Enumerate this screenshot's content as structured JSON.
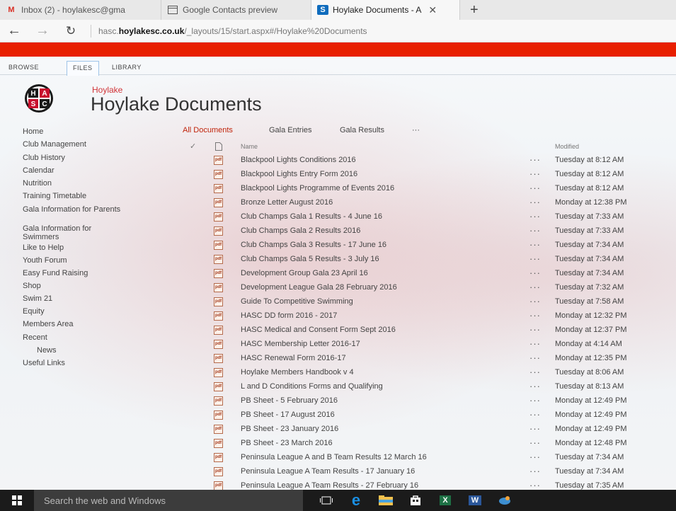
{
  "browser": {
    "tabs": [
      {
        "icon": "gmail-icon",
        "label": "Inbox (2) - hoylakesc@gma",
        "active": false
      },
      {
        "icon": "contacts-icon",
        "label": "Google Contacts preview",
        "active": false
      },
      {
        "icon": "sharepoint-icon",
        "label": "Hoylake Documents - A",
        "active": true
      }
    ],
    "url_prefix": "hasc.",
    "url_domain": "hoylakesc.co.uk",
    "url_path": "/_layouts/15/start.aspx#/Hoylake%20Documents"
  },
  "ribbon": {
    "tabs": [
      "BROWSE",
      "FILES",
      "LIBRARY"
    ]
  },
  "site": {
    "subtitle": "Hoylake",
    "title": "Hoylake Documents",
    "logo_letters": [
      "H",
      "A",
      "S",
      "C"
    ]
  },
  "nav": [
    {
      "label": "Home",
      "sub": false
    },
    {
      "label": "Club Management",
      "sub": false
    },
    {
      "label": "Club History",
      "sub": false
    },
    {
      "label": "Calendar",
      "sub": false
    },
    {
      "label": "Nutrition",
      "sub": false
    },
    {
      "label": "Training Timetable",
      "sub": false
    },
    {
      "label": "Gala Information for Parents",
      "sub": false
    },
    {
      "label": "Gala Information for Swimmers",
      "sub": false
    },
    {
      "label": "Like to Help",
      "sub": false
    },
    {
      "label": "Youth Forum",
      "sub": false
    },
    {
      "label": "Easy Fund Raising",
      "sub": false
    },
    {
      "label": "Shop",
      "sub": false
    },
    {
      "label": "Swim 21",
      "sub": false
    },
    {
      "label": "Equity",
      "sub": false
    },
    {
      "label": "Members Area",
      "sub": false
    },
    {
      "label": "Recent",
      "sub": false
    },
    {
      "label": "News",
      "sub": true
    },
    {
      "label": "Useful Links",
      "sub": false
    }
  ],
  "views": [
    "All Documents",
    "Gala Entries",
    "Gala Results",
    "···"
  ],
  "columns": {
    "check": "✓",
    "name": "Name",
    "modified": "Modified"
  },
  "documents": [
    {
      "name": "Blackpool Lights Conditions 2016",
      "modified": "Tuesday at 8:12 AM"
    },
    {
      "name": "Blackpool Lights Entry Form 2016",
      "modified": "Tuesday at 8:12 AM"
    },
    {
      "name": "Blackpool Lights Programme of Events 2016",
      "modified": "Tuesday at 8:12 AM"
    },
    {
      "name": "Bronze Letter August 2016",
      "modified": "Monday at 12:38 PM"
    },
    {
      "name": "Club Champs Gala 1 Results - 4 June 16",
      "modified": "Tuesday at 7:33 AM"
    },
    {
      "name": "Club Champs Gala 2 Results 2016",
      "modified": "Tuesday at 7:33 AM"
    },
    {
      "name": "Club Champs Gala 3 Results - 17 June 16",
      "modified": "Tuesday at 7:34 AM"
    },
    {
      "name": "Club Champs Gala 5 Results - 3 July 16",
      "modified": "Tuesday at 7:34 AM"
    },
    {
      "name": "Development Group Gala 23 April 16",
      "modified": "Tuesday at 7:34 AM"
    },
    {
      "name": "Development League Gala 28 February 2016",
      "modified": "Tuesday at 7:32 AM"
    },
    {
      "name": "Guide To Competitive Swimming",
      "modified": "Tuesday at 7:58 AM"
    },
    {
      "name": "HASC DD form 2016 - 2017",
      "modified": "Monday at 12:32 PM"
    },
    {
      "name": "HASC Medical and Consent Form Sept 2016",
      "modified": "Monday at 12:37 PM"
    },
    {
      "name": "HASC Membership Letter 2016-17",
      "modified": "Monday at 4:14 AM"
    },
    {
      "name": "HASC Renewal Form 2016-17",
      "modified": "Monday at 12:35 PM"
    },
    {
      "name": "Hoylake Members Handbook v 4",
      "modified": "Tuesday at 8:06 AM"
    },
    {
      "name": "L and D Conditions Forms and Qualifying",
      "modified": "Tuesday at 8:13 AM"
    },
    {
      "name": "PB Sheet - 5 February 2016",
      "modified": "Monday at 12:49 PM"
    },
    {
      "name": "PB Sheet - 17 August 2016",
      "modified": "Monday at 12:49 PM"
    },
    {
      "name": "PB Sheet - 23 January 2016",
      "modified": "Monday at 12:49 PM"
    },
    {
      "name": "PB Sheet - 23 March 2016",
      "modified": "Monday at 12:48 PM"
    },
    {
      "name": "Peninsula League A and B Team Results 12 March 16",
      "modified": "Tuesday at 7:34 AM"
    },
    {
      "name": "Peninsula League A Team Results - 17 January 16",
      "modified": "Tuesday at 7:34 AM"
    },
    {
      "name": "Peninsula League A Team Results - 27 February 16",
      "modified": "Tuesday at 7:35 AM"
    }
  ],
  "row_menu": "···",
  "file_icon_text": "pdf",
  "taskbar": {
    "search_placeholder": "Search the web and Windows",
    "icons": [
      "task-view-icon",
      "edge-icon",
      "file-explorer-icon",
      "store-icon",
      "excel-icon",
      "word-icon",
      "app-icon"
    ],
    "excel_letter": "X",
    "word_letter": "W"
  },
  "colors": {
    "accent": "#e81f00",
    "selected_view": "#c0240b",
    "taskbar": "#1b1b1b"
  }
}
